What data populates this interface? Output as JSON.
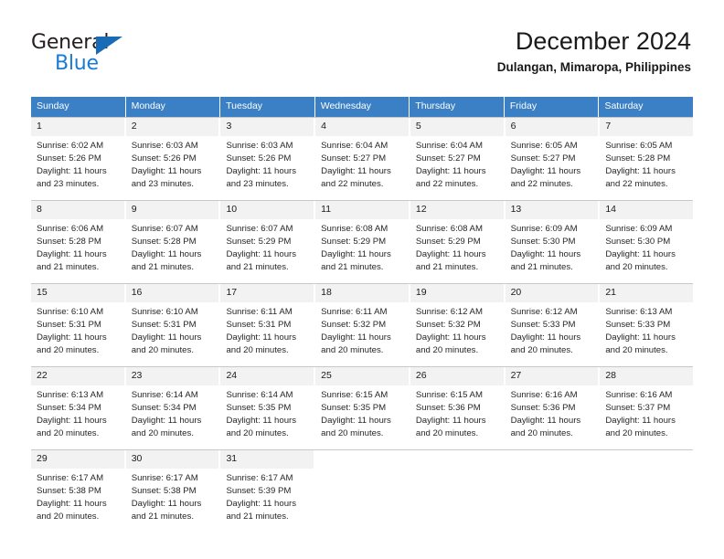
{
  "brand": {
    "name_part1": "General",
    "name_part2": "Blue",
    "triangle_color": "#1a6bb5",
    "blue_color": "#1a7bd4"
  },
  "header": {
    "title": "December 2024",
    "subtitle": "Dulangan, Mimaropa, Philippines"
  },
  "theme": {
    "header_row_bg": "#3b7fc4",
    "day_number_bg": "#f2f2f2",
    "grid_line": "#c8c8c8",
    "text": "#262626"
  },
  "calendar": {
    "weekdays": [
      "Sunday",
      "Monday",
      "Tuesday",
      "Wednesday",
      "Thursday",
      "Friday",
      "Saturday"
    ],
    "weeks": [
      [
        {
          "day": "1",
          "sunrise": "Sunrise: 6:02 AM",
          "sunset": "Sunset: 5:26 PM",
          "daylight": "Daylight: 11 hours and 23 minutes."
        },
        {
          "day": "2",
          "sunrise": "Sunrise: 6:03 AM",
          "sunset": "Sunset: 5:26 PM",
          "daylight": "Daylight: 11 hours and 23 minutes."
        },
        {
          "day": "3",
          "sunrise": "Sunrise: 6:03 AM",
          "sunset": "Sunset: 5:26 PM",
          "daylight": "Daylight: 11 hours and 23 minutes."
        },
        {
          "day": "4",
          "sunrise": "Sunrise: 6:04 AM",
          "sunset": "Sunset: 5:27 PM",
          "daylight": "Daylight: 11 hours and 22 minutes."
        },
        {
          "day": "5",
          "sunrise": "Sunrise: 6:04 AM",
          "sunset": "Sunset: 5:27 PM",
          "daylight": "Daylight: 11 hours and 22 minutes."
        },
        {
          "day": "6",
          "sunrise": "Sunrise: 6:05 AM",
          "sunset": "Sunset: 5:27 PM",
          "daylight": "Daylight: 11 hours and 22 minutes."
        },
        {
          "day": "7",
          "sunrise": "Sunrise: 6:05 AM",
          "sunset": "Sunset: 5:28 PM",
          "daylight": "Daylight: 11 hours and 22 minutes."
        }
      ],
      [
        {
          "day": "8",
          "sunrise": "Sunrise: 6:06 AM",
          "sunset": "Sunset: 5:28 PM",
          "daylight": "Daylight: 11 hours and 21 minutes."
        },
        {
          "day": "9",
          "sunrise": "Sunrise: 6:07 AM",
          "sunset": "Sunset: 5:28 PM",
          "daylight": "Daylight: 11 hours and 21 minutes."
        },
        {
          "day": "10",
          "sunrise": "Sunrise: 6:07 AM",
          "sunset": "Sunset: 5:29 PM",
          "daylight": "Daylight: 11 hours and 21 minutes."
        },
        {
          "day": "11",
          "sunrise": "Sunrise: 6:08 AM",
          "sunset": "Sunset: 5:29 PM",
          "daylight": "Daylight: 11 hours and 21 minutes."
        },
        {
          "day": "12",
          "sunrise": "Sunrise: 6:08 AM",
          "sunset": "Sunset: 5:29 PM",
          "daylight": "Daylight: 11 hours and 21 minutes."
        },
        {
          "day": "13",
          "sunrise": "Sunrise: 6:09 AM",
          "sunset": "Sunset: 5:30 PM",
          "daylight": "Daylight: 11 hours and 21 minutes."
        },
        {
          "day": "14",
          "sunrise": "Sunrise: 6:09 AM",
          "sunset": "Sunset: 5:30 PM",
          "daylight": "Daylight: 11 hours and 20 minutes."
        }
      ],
      [
        {
          "day": "15",
          "sunrise": "Sunrise: 6:10 AM",
          "sunset": "Sunset: 5:31 PM",
          "daylight": "Daylight: 11 hours and 20 minutes."
        },
        {
          "day": "16",
          "sunrise": "Sunrise: 6:10 AM",
          "sunset": "Sunset: 5:31 PM",
          "daylight": "Daylight: 11 hours and 20 minutes."
        },
        {
          "day": "17",
          "sunrise": "Sunrise: 6:11 AM",
          "sunset": "Sunset: 5:31 PM",
          "daylight": "Daylight: 11 hours and 20 minutes."
        },
        {
          "day": "18",
          "sunrise": "Sunrise: 6:11 AM",
          "sunset": "Sunset: 5:32 PM",
          "daylight": "Daylight: 11 hours and 20 minutes."
        },
        {
          "day": "19",
          "sunrise": "Sunrise: 6:12 AM",
          "sunset": "Sunset: 5:32 PM",
          "daylight": "Daylight: 11 hours and 20 minutes."
        },
        {
          "day": "20",
          "sunrise": "Sunrise: 6:12 AM",
          "sunset": "Sunset: 5:33 PM",
          "daylight": "Daylight: 11 hours and 20 minutes."
        },
        {
          "day": "21",
          "sunrise": "Sunrise: 6:13 AM",
          "sunset": "Sunset: 5:33 PM",
          "daylight": "Daylight: 11 hours and 20 minutes."
        }
      ],
      [
        {
          "day": "22",
          "sunrise": "Sunrise: 6:13 AM",
          "sunset": "Sunset: 5:34 PM",
          "daylight": "Daylight: 11 hours and 20 minutes."
        },
        {
          "day": "23",
          "sunrise": "Sunrise: 6:14 AM",
          "sunset": "Sunset: 5:34 PM",
          "daylight": "Daylight: 11 hours and 20 minutes."
        },
        {
          "day": "24",
          "sunrise": "Sunrise: 6:14 AM",
          "sunset": "Sunset: 5:35 PM",
          "daylight": "Daylight: 11 hours and 20 minutes."
        },
        {
          "day": "25",
          "sunrise": "Sunrise: 6:15 AM",
          "sunset": "Sunset: 5:35 PM",
          "daylight": "Daylight: 11 hours and 20 minutes."
        },
        {
          "day": "26",
          "sunrise": "Sunrise: 6:15 AM",
          "sunset": "Sunset: 5:36 PM",
          "daylight": "Daylight: 11 hours and 20 minutes."
        },
        {
          "day": "27",
          "sunrise": "Sunrise: 6:16 AM",
          "sunset": "Sunset: 5:36 PM",
          "daylight": "Daylight: 11 hours and 20 minutes."
        },
        {
          "day": "28",
          "sunrise": "Sunrise: 6:16 AM",
          "sunset": "Sunset: 5:37 PM",
          "daylight": "Daylight: 11 hours and 20 minutes."
        }
      ],
      [
        {
          "day": "29",
          "sunrise": "Sunrise: 6:17 AM",
          "sunset": "Sunset: 5:38 PM",
          "daylight": "Daylight: 11 hours and 20 minutes."
        },
        {
          "day": "30",
          "sunrise": "Sunrise: 6:17 AM",
          "sunset": "Sunset: 5:38 PM",
          "daylight": "Daylight: 11 hours and 21 minutes."
        },
        {
          "day": "31",
          "sunrise": "Sunrise: 6:17 AM",
          "sunset": "Sunset: 5:39 PM",
          "daylight": "Daylight: 11 hours and 21 minutes."
        },
        {
          "day": "",
          "sunrise": "",
          "sunset": "",
          "daylight": ""
        },
        {
          "day": "",
          "sunrise": "",
          "sunset": "",
          "daylight": ""
        },
        {
          "day": "",
          "sunrise": "",
          "sunset": "",
          "daylight": ""
        },
        {
          "day": "",
          "sunrise": "",
          "sunset": "",
          "daylight": ""
        }
      ]
    ]
  }
}
